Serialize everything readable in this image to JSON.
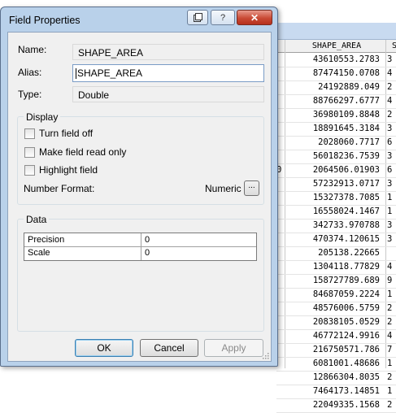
{
  "dialog": {
    "title": "Field Properties",
    "name_label": "Name:",
    "name_value": "SHAPE_AREA",
    "alias_label": "Alias:",
    "alias_value": "SHAPE_AREA",
    "type_label": "Type:",
    "type_value": "Double",
    "display": {
      "title": "Display",
      "turn_off": "Turn field off",
      "read_only": "Make field read only",
      "highlight": "Highlight field",
      "number_format_label": "Number Format:",
      "number_format_value": "Numeric",
      "ellipsis": "..."
    },
    "data": {
      "title": "Data",
      "rows": [
        {
          "label": "Precision",
          "value": "0"
        },
        {
          "label": "Scale",
          "value": "0"
        }
      ]
    },
    "buttons": {
      "ok": "OK",
      "cancel": "Cancel",
      "apply": "Apply"
    },
    "titlebar_buttons": {
      "help": "?",
      "close": "✕"
    }
  },
  "table": {
    "header_area": "SHAPE_AREA",
    "header_next": "S",
    "stray_text": "0",
    "rows": [
      {
        "area": "43610553.2783",
        "next": "3"
      },
      {
        "area": "87474150.0708",
        "next": "4"
      },
      {
        "area": "24192889.049",
        "next": "2"
      },
      {
        "area": "88766297.6777",
        "next": "4"
      },
      {
        "area": "36980109.8848",
        "next": "2"
      },
      {
        "area": "18891645.3184",
        "next": "3"
      },
      {
        "area": "2028060.7717",
        "next": "6"
      },
      {
        "area": "56018236.7539",
        "next": "3"
      },
      {
        "area": "2064506.01903",
        "next": "6"
      },
      {
        "area": "57232913.0717",
        "next": "3"
      },
      {
        "area": "15327378.7085",
        "next": "1"
      },
      {
        "area": "16558024.1467",
        "next": "1"
      },
      {
        "area": "342733.970788",
        "next": "3"
      },
      {
        "area": "470374.120615",
        "next": "3"
      },
      {
        "area": "205138.22665",
        "next": ""
      },
      {
        "area": "1304118.77829",
        "next": "4"
      },
      {
        "area": "158727789.689",
        "next": "9"
      },
      {
        "area": "84687059.2224",
        "next": "1"
      },
      {
        "area": "48576006.5759",
        "next": "2"
      },
      {
        "area": "20838105.0529",
        "next": "2"
      },
      {
        "area": "46772124.9916",
        "next": "4"
      },
      {
        "area": "216750571.786",
        "next": "7"
      },
      {
        "area": "6081001.48686",
        "next": "1"
      },
      {
        "area": "12866304.8035",
        "next": "2"
      },
      {
        "area": "7464173.14851",
        "next": "1"
      },
      {
        "area": "22049335.1568",
        "next": "2"
      }
    ]
  }
}
